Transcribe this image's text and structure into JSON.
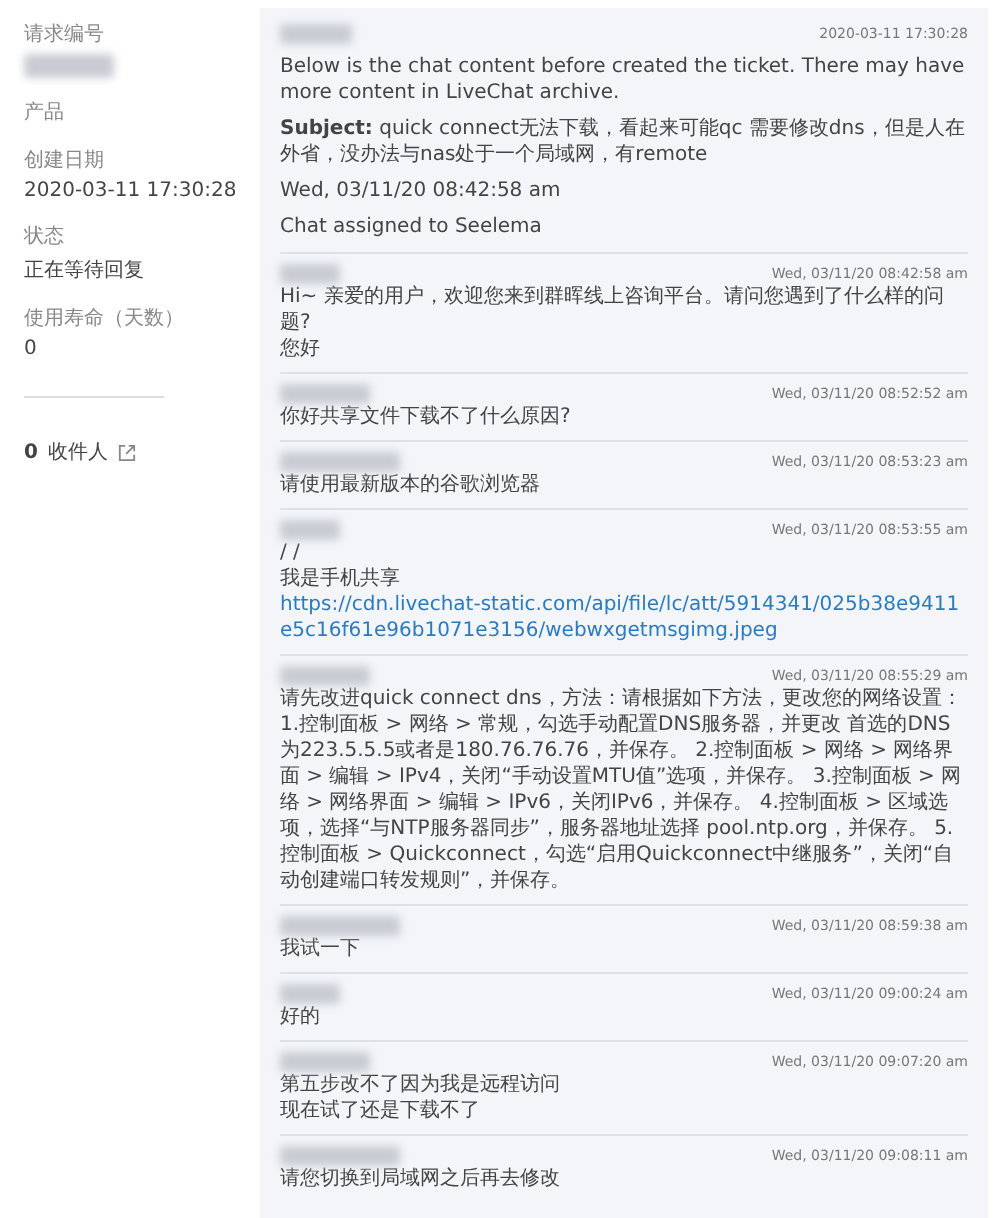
{
  "sidebar": {
    "fields": [
      {
        "label": "请求编号",
        "value_blurred": true
      },
      {
        "label": "产品"
      },
      {
        "label": "创建日期",
        "value": "2020-03-11 17:30:28"
      },
      {
        "label": "状态",
        "value": "正在等待回复"
      },
      {
        "label": "使用寿命（天数）",
        "value": "0"
      }
    ],
    "recipients": {
      "count": "0",
      "label": "收件人"
    }
  },
  "intro": {
    "time": "2020-03-11 17:30:28",
    "text": "Below is the chat content before created the ticket. There may have more content in LiveChat archive.",
    "subject_label": "Subject:",
    "subject": "quick connect无法下载，看起来可能qc 需要修改dns，但是人在外省，没办法与nas处于一个局域网，有remote",
    "date": "Wed, 03/11/20 08:42:58 am",
    "assigned": "Chat assigned to Seelema"
  },
  "messages": [
    {
      "time": "Wed, 03/11/20 08:42:58 am",
      "lines": [
        {
          "kind": "text",
          "text": "Hi~ 亲爱的用户，欢迎您来到群晖线上咨询平台。请问您遇到了什么样的问题?"
        },
        {
          "kind": "text",
          "text": "您好"
        }
      ]
    },
    {
      "time": "Wed, 03/11/20 08:52:52 am",
      "lines": [
        {
          "kind": "text",
          "text": "你好共享文件下载不了什么原因?"
        }
      ]
    },
    {
      "time": "Wed, 03/11/20 08:53:23 am",
      "lines": [
        {
          "kind": "text",
          "text": "请使用最新版本的谷歌浏览器"
        }
      ]
    },
    {
      "time": "Wed, 03/11/20 08:53:55 am",
      "lines": [
        {
          "kind": "text",
          "text": "/ /"
        },
        {
          "kind": "text",
          "text": "我是手机共享"
        },
        {
          "kind": "link",
          "text": "https://cdn.livechat-static.com/api/file/lc/att/5914341/025b38e9411e5c16f61e96b1071e3156/webwxgetmsgimg.jpeg"
        }
      ]
    },
    {
      "time": "Wed, 03/11/20 08:55:29 am",
      "lines": [
        {
          "kind": "text",
          "text": "请先改进quick connect dns，方法：请根据如下方法，更改您的网络设置： 1.控制面板 > 网络 > 常规，勾选手动配置DNS服务器，并更改 首选的DNS 为223.5.5.5或者是180.76.76.76，并保存。 2.控制面板 > 网络 > 网络界面 > 编辑 > IPv4，关闭“手动设置MTU值”选项，并保存。 3.控制面板 > 网络 > 网络界面 > 编辑 > IPv6，关闭IPv6，并保存。 4.控制面板 > 区域选项，选择“与NTP服务器同步”，服务器地址选择 pool.ntp.org，并保存。 5.控制面板 > Quickconnect，勾选“启用Quickconnect中继服务”，关闭“自动创建端口转发规则”，并保存。"
        }
      ]
    },
    {
      "time": "Wed, 03/11/20 08:59:38 am",
      "lines": [
        {
          "kind": "text",
          "text": "我试一下"
        }
      ]
    },
    {
      "time": "Wed, 03/11/20 09:00:24 am",
      "lines": [
        {
          "kind": "text",
          "text": "好的"
        }
      ]
    },
    {
      "time": "Wed, 03/11/20 09:07:20 am",
      "lines": [
        {
          "kind": "text",
          "text": "第五步改不了因为我是远程访问"
        },
        {
          "kind": "text",
          "text": "现在试了还是下载不了"
        }
      ]
    },
    {
      "time": "Wed, 03/11/20 09:08:11 am",
      "lines": [
        {
          "kind": "text",
          "text": "请您切换到局域网之后再去修改"
        }
      ]
    }
  ]
}
